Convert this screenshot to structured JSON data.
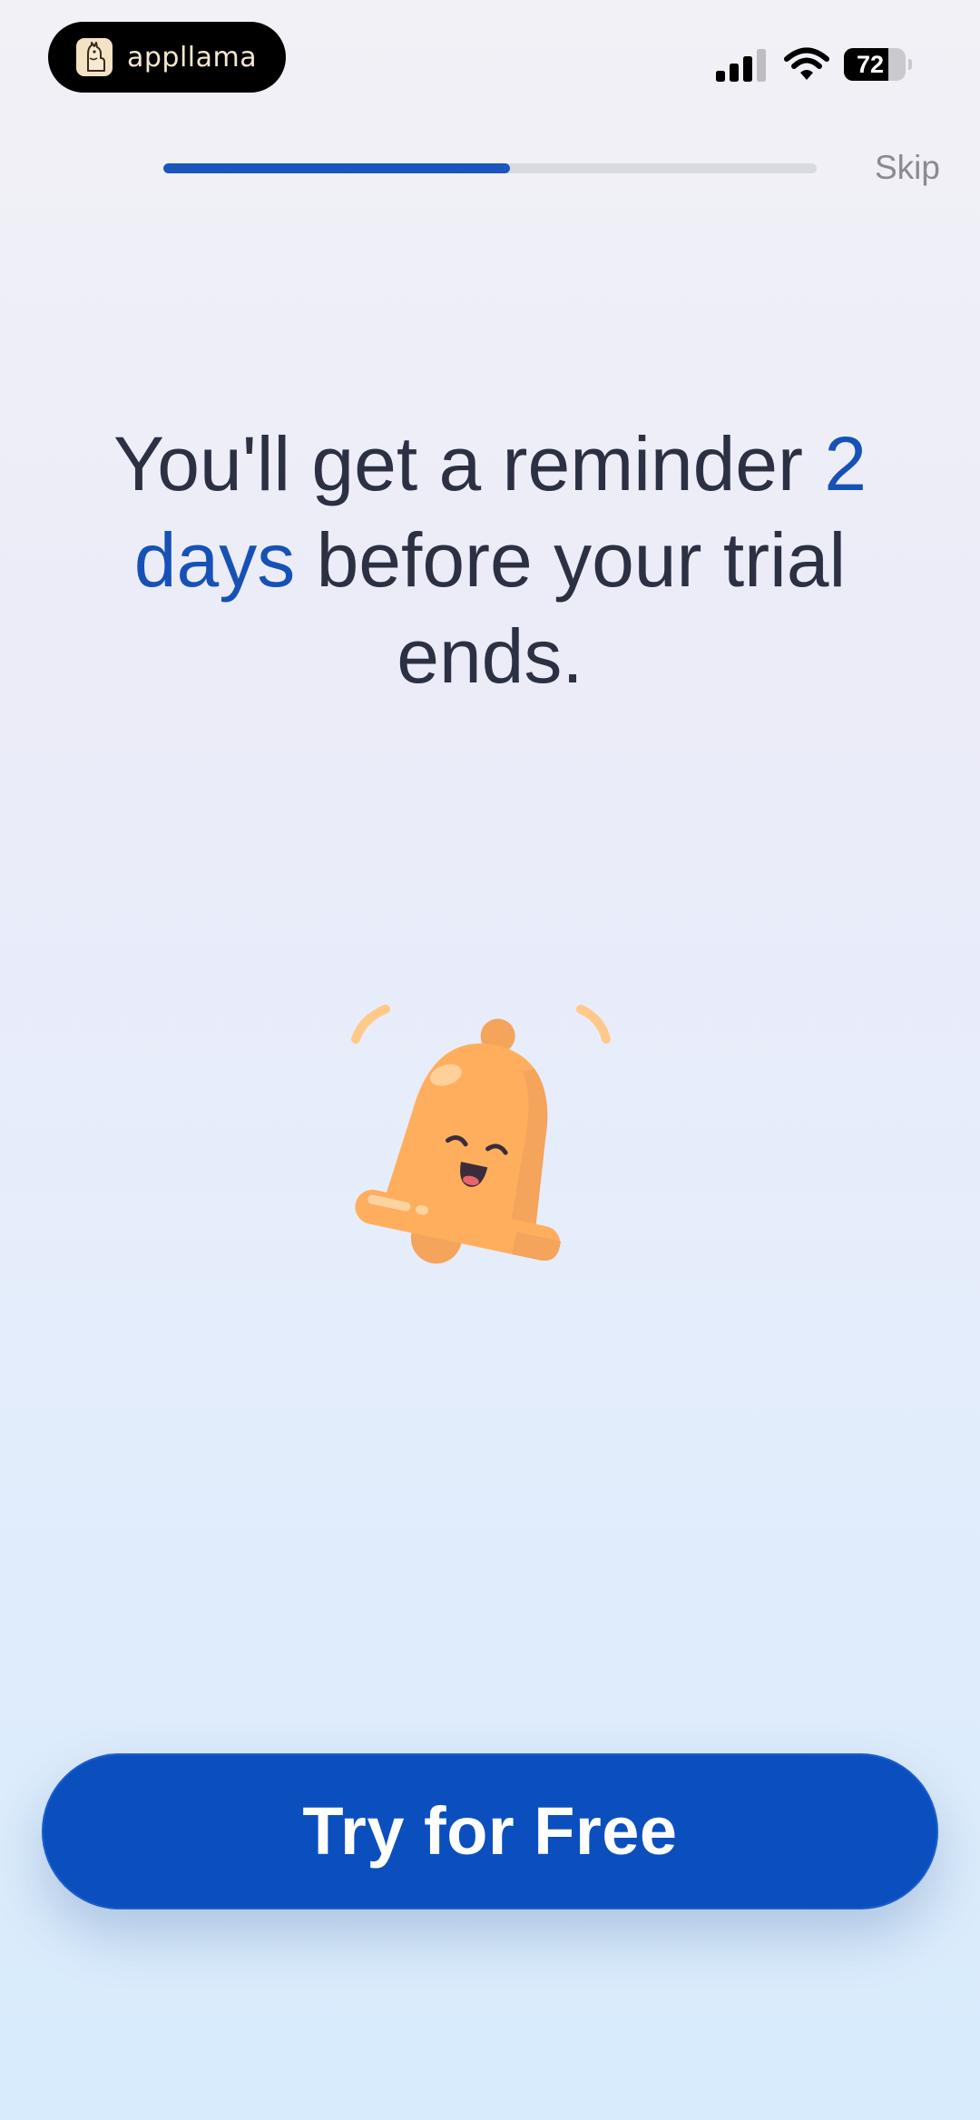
{
  "status_bar": {
    "app_name": "appllama",
    "battery_level": "72",
    "battery_fraction": 0.72,
    "icons": [
      "llama-logo-icon",
      "cellular-signal-icon",
      "wifi-icon",
      "battery-icon"
    ]
  },
  "onboarding": {
    "progress_fraction": 0.53,
    "skip_label": "Skip"
  },
  "headline": {
    "part1": "You'll get a reminder ",
    "highlight": "2 days",
    "part2": " before your trial ends."
  },
  "illustration": {
    "icon": "smiling-bell-icon"
  },
  "cta": {
    "label": "Try for Free"
  },
  "colors": {
    "accent": "#0B4FBF",
    "highlight_text": "#1652B6",
    "headline_text": "#2C3043",
    "bell": "#FFAE5E"
  }
}
